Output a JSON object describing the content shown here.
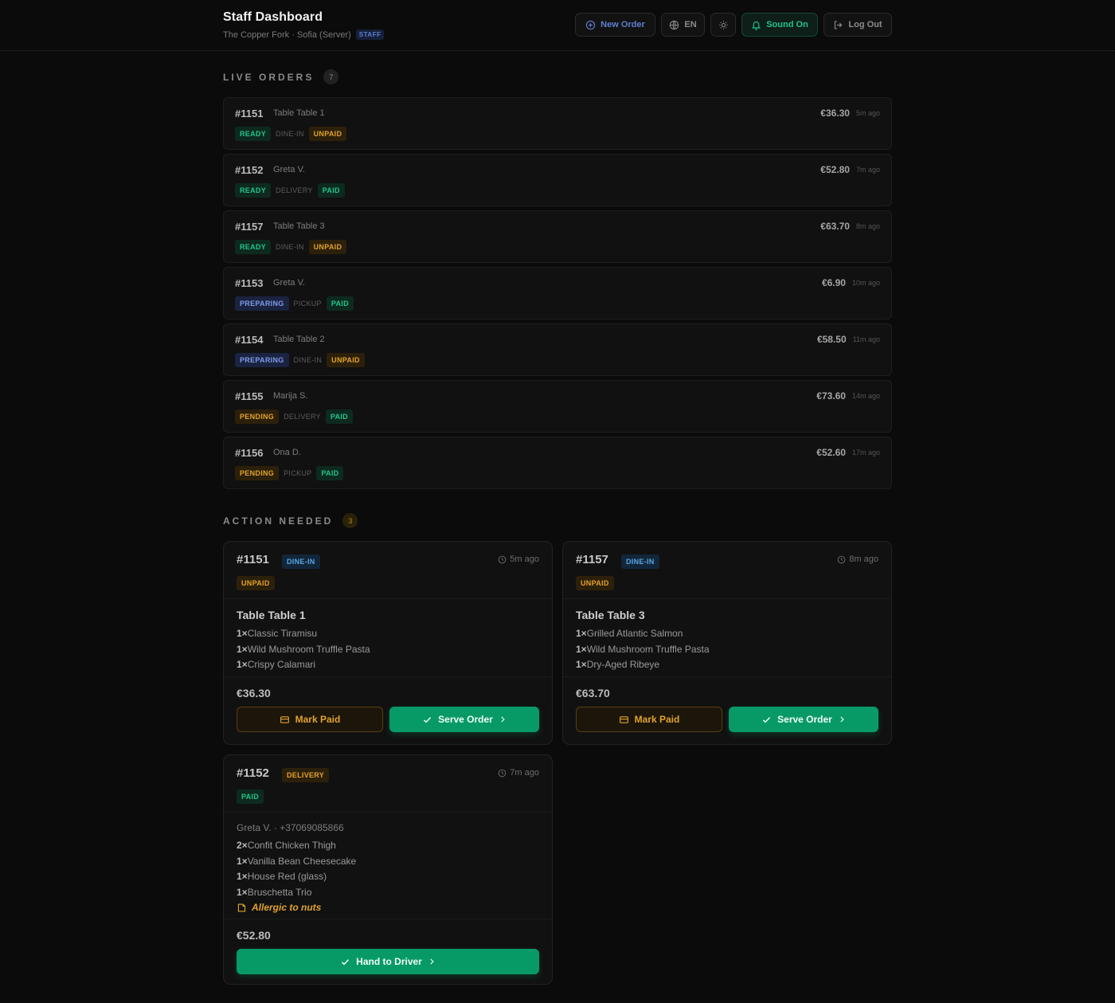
{
  "header": {
    "title": "Staff Dashboard",
    "subtitle": "The Copper Fork · Sofia (Server)",
    "role_badge": "STAFF",
    "buttons": {
      "new_order": "New Order",
      "language": "EN",
      "sound": "Sound On",
      "logout": "Log Out"
    }
  },
  "live_orders": {
    "title": "LIVE ORDERS",
    "count": "7",
    "orders": [
      {
        "number": "#1151",
        "name": "Table Table 1",
        "price": "€36.30",
        "ago": "5m ago",
        "status": "READY",
        "type": "DINE-IN",
        "payment": "UNPAID"
      },
      {
        "number": "#1152",
        "name": "Greta V.",
        "price": "€52.80",
        "ago": "7m ago",
        "status": "READY",
        "type": "DELIVERY",
        "payment": "PAID"
      },
      {
        "number": "#1157",
        "name": "Table Table 3",
        "price": "€63.70",
        "ago": "8m ago",
        "status": "READY",
        "type": "DINE-IN",
        "payment": "UNPAID"
      },
      {
        "number": "#1153",
        "name": "Greta V.",
        "price": "€6.90",
        "ago": "10m ago",
        "status": "PREPARING",
        "type": "PICKUP",
        "payment": "PAID"
      },
      {
        "number": "#1154",
        "name": "Table Table 2",
        "price": "€58.50",
        "ago": "11m ago",
        "status": "PREPARING",
        "type": "DINE-IN",
        "payment": "UNPAID"
      },
      {
        "number": "#1155",
        "name": "Marija S.",
        "price": "€73.60",
        "ago": "14m ago",
        "status": "PENDING",
        "type": "DELIVERY",
        "payment": "PAID"
      },
      {
        "number": "#1156",
        "name": "Ona D.",
        "price": "€52.60",
        "ago": "17m ago",
        "status": "PENDING",
        "type": "PICKUP",
        "payment": "PAID"
      }
    ]
  },
  "action_needed": {
    "title": "ACTION NEEDED",
    "count": "3",
    "cards": [
      {
        "number": "#1151",
        "type": "DINE-IN",
        "payment": "UNPAID",
        "ago": "5m ago",
        "table": "Table Table 1",
        "items": [
          {
            "qty": "1×",
            "name": "Classic Tiramisu"
          },
          {
            "qty": "1×",
            "name": "Wild Mushroom Truffle Pasta"
          },
          {
            "qty": "1×",
            "name": "Crispy Calamari"
          }
        ],
        "total": "€36.30",
        "mark_paid": "Mark Paid",
        "serve": "Serve Order"
      },
      {
        "number": "#1157",
        "type": "DINE-IN",
        "payment": "UNPAID",
        "ago": "8m ago",
        "table": "Table Table 3",
        "items": [
          {
            "qty": "1×",
            "name": "Grilled Atlantic Salmon"
          },
          {
            "qty": "1×",
            "name": "Wild Mushroom Truffle Pasta"
          },
          {
            "qty": "1×",
            "name": "Dry-Aged Ribeye"
          }
        ],
        "total": "€63.70",
        "mark_paid": "Mark Paid",
        "serve": "Serve Order"
      },
      {
        "number": "#1152",
        "type": "DELIVERY",
        "payment": "PAID",
        "ago": "7m ago",
        "contact": "Greta V. · +37069085866",
        "items": [
          {
            "qty": "2×",
            "name": "Confit Chicken Thigh"
          },
          {
            "qty": "1×",
            "name": "Vanilla Bean Cheesecake"
          },
          {
            "qty": "1×",
            "name": "House Red (glass)"
          },
          {
            "qty": "1×",
            "name": "Bruschetta Trio"
          }
        ],
        "note": "Allergic to nuts",
        "total": "€52.80",
        "handoff": "Hand to Driver"
      }
    ]
  },
  "colors": {
    "background": "#0b0b0b",
    "accent_green": "#079a67",
    "status_green": "#22c58b",
    "status_amber": "#e1a32c",
    "status_blue": "#7f9ae6"
  }
}
